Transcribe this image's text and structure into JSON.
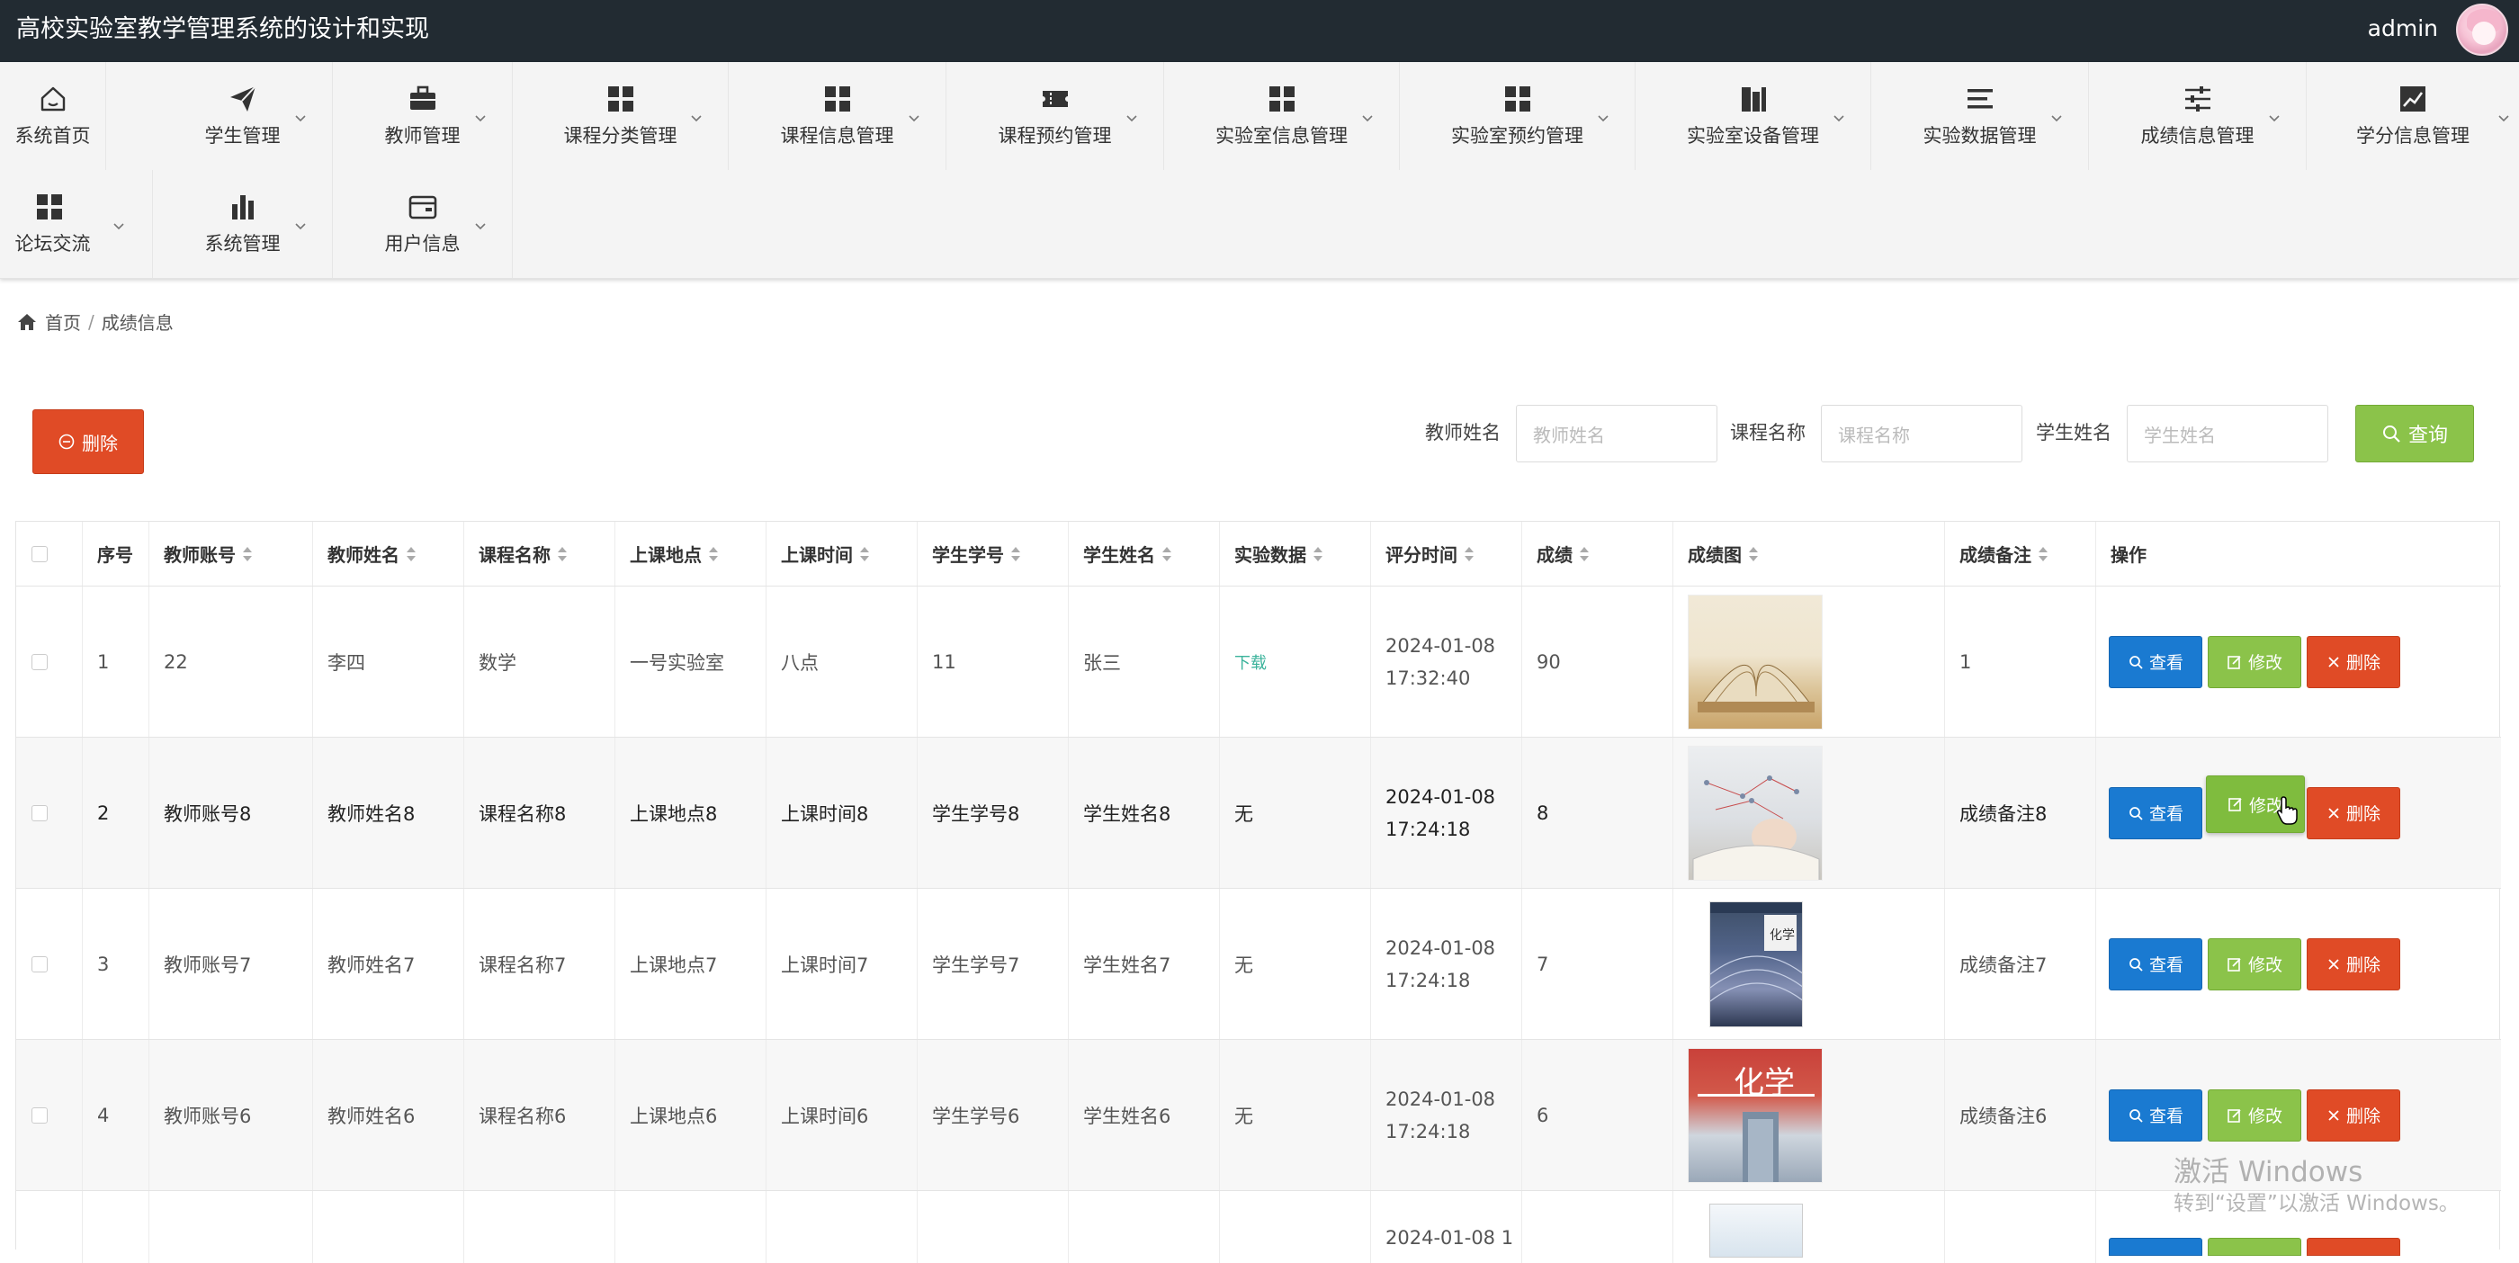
{
  "app": {
    "title": "高校实验室教学管理系统的设计和实现",
    "user": "admin"
  },
  "nav": {
    "items": [
      {
        "label": "系统首页",
        "icon": "home-icon"
      },
      {
        "label": "学生管理",
        "icon": "send-icon"
      },
      {
        "label": "教师管理",
        "icon": "briefcase-icon"
      },
      {
        "label": "课程分类管理",
        "icon": "grid-icon"
      },
      {
        "label": "课程信息管理",
        "icon": "grid-icon"
      },
      {
        "label": "课程预约管理",
        "icon": "ticket-icon"
      },
      {
        "label": "实验室信息管理",
        "icon": "grid-icon"
      },
      {
        "label": "实验室预约管理",
        "icon": "grid-icon"
      },
      {
        "label": "实验室设备管理",
        "icon": "building-icon"
      },
      {
        "label": "实验数据管理",
        "icon": "list-icon"
      },
      {
        "label": "成绩信息管理",
        "icon": "sliders-icon"
      },
      {
        "label": "学分信息管理",
        "icon": "chart-line-icon"
      },
      {
        "label": "论坛交流",
        "icon": "grid-icon"
      },
      {
        "label": "系统管理",
        "icon": "bar-chart-icon"
      },
      {
        "label": "用户信息",
        "icon": "wallet-icon"
      }
    ]
  },
  "breadcrumb": {
    "home": "首页",
    "sep": "/",
    "current": "成绩信息"
  },
  "toolbar": {
    "delete_label": "删除"
  },
  "search": {
    "teacher_label": "教师姓名",
    "teacher_placeholder": "教师姓名",
    "course_label": "课程名称",
    "course_placeholder": "课程名称",
    "student_label": "学生姓名",
    "student_placeholder": "学生姓名",
    "query_label": "查询"
  },
  "table": {
    "headers": [
      "序号",
      "教师账号",
      "教师姓名",
      "课程名称",
      "上课地点",
      "上课时间",
      "学生学号",
      "学生姓名",
      "实验数据",
      "评分时间",
      "成绩",
      "成绩图",
      "成绩备注",
      "操作"
    ],
    "rows": [
      {
        "no": "1",
        "teacher_account": "22",
        "teacher_name": "李四",
        "course": "数学",
        "location": "一号实验室",
        "time": "八点",
        "student_id": "11",
        "student_name": "张三",
        "data": "下载",
        "scored_at": "2024-01-08 17:32:40",
        "score": "90",
        "remark": "1"
      },
      {
        "no": "2",
        "teacher_account": "教师账号8",
        "teacher_name": "教师姓名8",
        "course": "课程名称8",
        "location": "上课地点8",
        "time": "上课时间8",
        "student_id": "学生学号8",
        "student_name": "学生姓名8",
        "data": "无",
        "scored_at": "2024-01-08 17:24:18",
        "score": "8",
        "remark": "成绩备注8"
      },
      {
        "no": "3",
        "teacher_account": "教师账号7",
        "teacher_name": "教师姓名7",
        "course": "课程名称7",
        "location": "上课地点7",
        "time": "上课时间7",
        "student_id": "学生学号7",
        "student_name": "学生姓名7",
        "data": "无",
        "scored_at": "2024-01-08 17:24:18",
        "score": "7",
        "remark": "成绩备注7"
      },
      {
        "no": "4",
        "teacher_account": "教师账号6",
        "teacher_name": "教师姓名6",
        "course": "课程名称6",
        "location": "上课地点6",
        "time": "上课时间6",
        "student_id": "学生学号6",
        "student_name": "学生姓名6",
        "data": "无",
        "scored_at": "2024-01-08 17:24:18",
        "score": "6",
        "remark": "成绩备注6"
      },
      {
        "scored_at": "2024-01-08 1"
      }
    ],
    "actions": {
      "view": "查看",
      "edit": "修改",
      "delete": "删除"
    }
  },
  "watermark": {
    "line1": "激活 Windows",
    "line2": "转到“设置”以激活 Windows。"
  },
  "colors": {
    "topbar": "#222b32",
    "danger": "#e04b26",
    "success": "#8bc34a",
    "primary": "#1a7ad1"
  }
}
